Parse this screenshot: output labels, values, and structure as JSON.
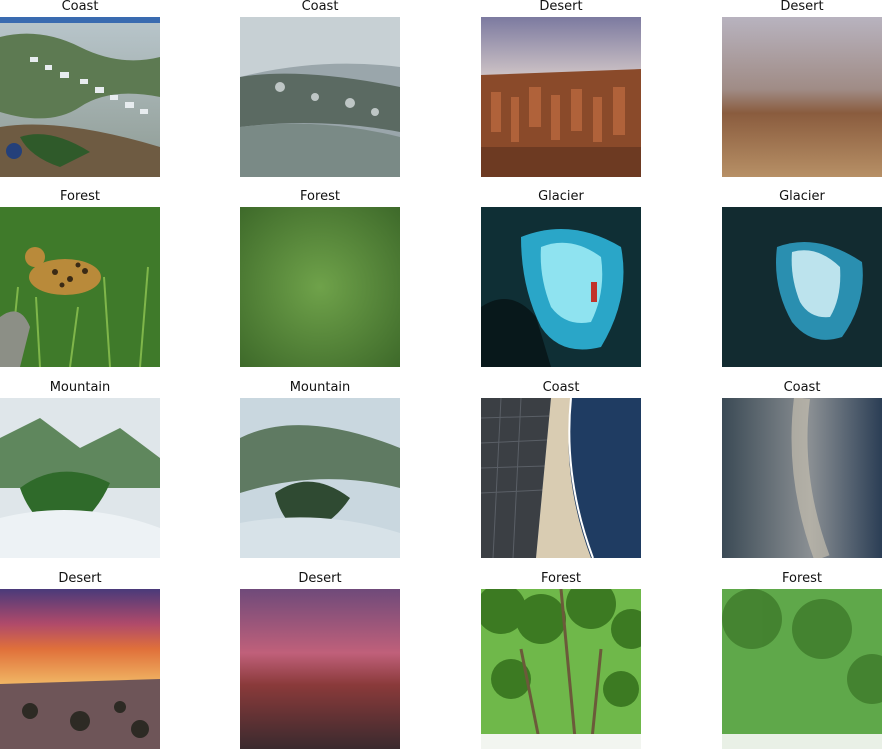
{
  "figure": {
    "row1": [
      "Coast",
      "Coast",
      "Desert",
      "Desert"
    ],
    "row2": [
      "Forest",
      "Forest",
      "Glacier",
      "Glacier"
    ],
    "row3": [
      "Mountain",
      "Mountain",
      "Coast",
      "Coast"
    ],
    "row4": [
      "Desert",
      "Desert",
      "Forest",
      "Forest"
    ]
  },
  "colors": {
    "coast_water": "#6b7a6c",
    "desert_rock": "#8a4a2a",
    "forest_green": "#3f7a2a",
    "glacier_ice": "#2aa6c8",
    "mountain_mist": "#dfe6ea",
    "sunset_orange": "#e0703a"
  },
  "icons": [
    "landscape-photo",
    "generated-image"
  ]
}
